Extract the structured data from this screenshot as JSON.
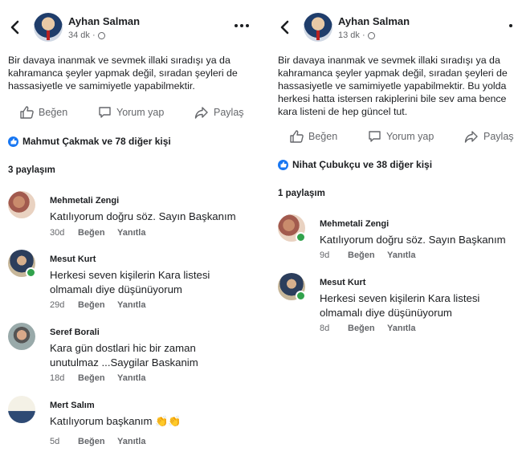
{
  "left": {
    "author": "Ayhan Salman",
    "time": "34 dk ·",
    "post_lines": [
      "Bir davaya inanmak ve sevmek illaki sıradışı ya da",
      "kahramanca şeyler yapmak değil, sıradan şeyleri de",
      "hassasiyetle ve samimiyetle yapabilmektir."
    ],
    "actions": {
      "like": "Beğen",
      "comment": "Yorum yap",
      "share": "Paylaş"
    },
    "likes": "Mahmut Çakmak ve 78 diğer kişi",
    "shares": "3 paylaşım",
    "comments": [
      {
        "name": "Mehmetali Zengi",
        "text": "Katılıyorum doğru söz. Sayın Başkanım",
        "time": "30d",
        "like": "Beğen",
        "reply": "Yanıtla"
      },
      {
        "name": "Mesut Kurt",
        "text": "Herkesi seven kişilerin Kara listesi\nolmamalı diye düşünüyorum",
        "time": "29d",
        "like": "Beğen",
        "reply": "Yanıtla"
      },
      {
        "name": "Seref Borali",
        "text": "Kara gün dostlari hic bir zaman\nunutulmaz ...Saygilar Baskanim",
        "time": "18d",
        "like": "Beğen",
        "reply": "Yanıtla"
      },
      {
        "name": "Mert Salım",
        "text": "Katılıyorum başkanım",
        "emoji": "👏👏",
        "time": "5d",
        "like": "Beğen",
        "reply": "Yanıtla"
      }
    ]
  },
  "right": {
    "author": "Ayhan Salman",
    "time": "13 dk ·",
    "post_lines": [
      "Bir davaya inanmak ve sevmek illaki sıradışı ya da",
      "kahramanca şeyler yapmak değil, sıradan şeyleri de",
      "hassasiyetle ve samimiyetle yapabilmektir. Bu yolda",
      "herkesi hatta istersen rakiplerini bile sev ama bence",
      "kara listeni de hep güncel tut."
    ],
    "actions": {
      "like": "Beğen",
      "comment": "Yorum yap",
      "share": "Paylaş"
    },
    "likes": "Nihat Çubukçu ve 38 diğer kişi",
    "shares": "1 paylaşım",
    "comments": [
      {
        "name": "Mehmetali Zengi",
        "text": "Katılıyorum doğru söz. Sayın Başkanım",
        "time": "9d",
        "like": "Beğen",
        "reply": "Yanıtla"
      },
      {
        "name": "Mesut Kurt",
        "text": "Herkesi seven kişilerin Kara listesi\nolmamalı diye düşünüyorum",
        "time": "8d",
        "like": "Beğen",
        "reply": "Yanıtla"
      }
    ]
  },
  "colors": {
    "accent": "#1877f2",
    "secondary_text": "#65676b",
    "online": "#31a24c"
  },
  "icons": [
    "back-arrow-icon",
    "globe-icon",
    "more-icon",
    "like-icon",
    "comment-icon",
    "share-icon",
    "like-badge-icon"
  ]
}
